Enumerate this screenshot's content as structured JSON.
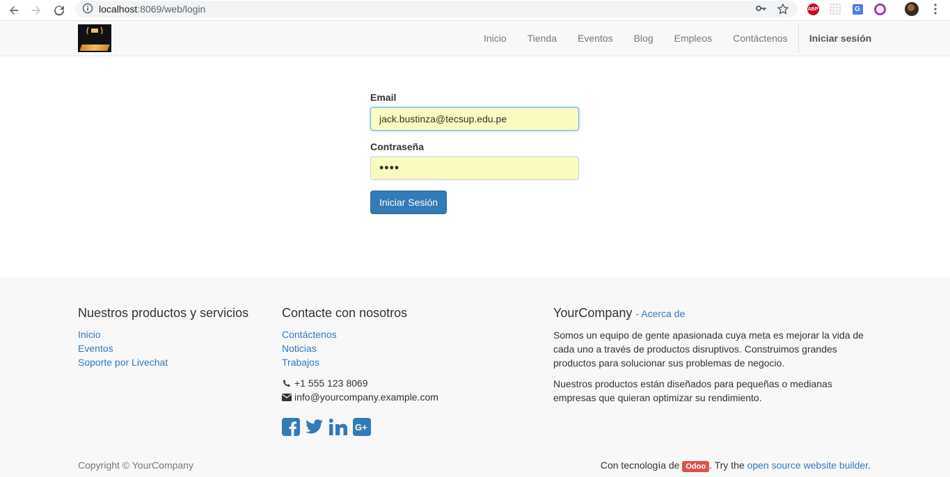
{
  "browser": {
    "url_host": "localhost",
    "url_path": ":8069/web/login"
  },
  "navbar": {
    "items": [
      {
        "label": "Inicio"
      },
      {
        "label": "Tienda"
      },
      {
        "label": "Eventos"
      },
      {
        "label": "Blog"
      },
      {
        "label": "Empleos"
      },
      {
        "label": "Contáctenos"
      }
    ],
    "signin_label": "Iniciar sesión"
  },
  "login": {
    "email_label": "Email",
    "email_value": "jack.bustinza@tecsup.edu.pe",
    "password_label": "Contraseña",
    "password_masked": "••••",
    "submit_label": "Iniciar Sesión"
  },
  "footer": {
    "products": {
      "title": "Nuestros productos y servicios",
      "links": [
        "Inicio",
        "Eventos",
        "Soporte por Livechat"
      ]
    },
    "contact": {
      "title": "Contacte con nosotros",
      "links": [
        "Contáctenos",
        "Noticias",
        "Trabajos"
      ],
      "phone": "+1 555 123 8069",
      "email": "info@yourcompany.example.com",
      "social": [
        "facebook-icon",
        "twitter-icon",
        "linkedin-icon",
        "google-plus-icon"
      ]
    },
    "about": {
      "company": "YourCompany",
      "about_link": "- Acerca de",
      "paragraph1": "Somos un equipo de gente apasionada cuya meta es mejorar la vida de cada uno a través de productos disruptivos. Construimos grandes productos para solucionar sus problemas de negocio.",
      "paragraph2": "Nuestros productos están diseñados para pequeñas o medianas empresas que quieran optimizar su rendimiento."
    },
    "copyright": "Copyright © YourCompany",
    "powered_prefix": "Con tecnología de",
    "powered_badge": "Odoo",
    "powered_middle": ". Try the",
    "powered_link": "open source website builder",
    "powered_suffix": "."
  },
  "colors": {
    "link": "#337ab7",
    "button": "#337ab7",
    "autofill": "#fafbc0",
    "odoo_badge": "#d9534f"
  }
}
